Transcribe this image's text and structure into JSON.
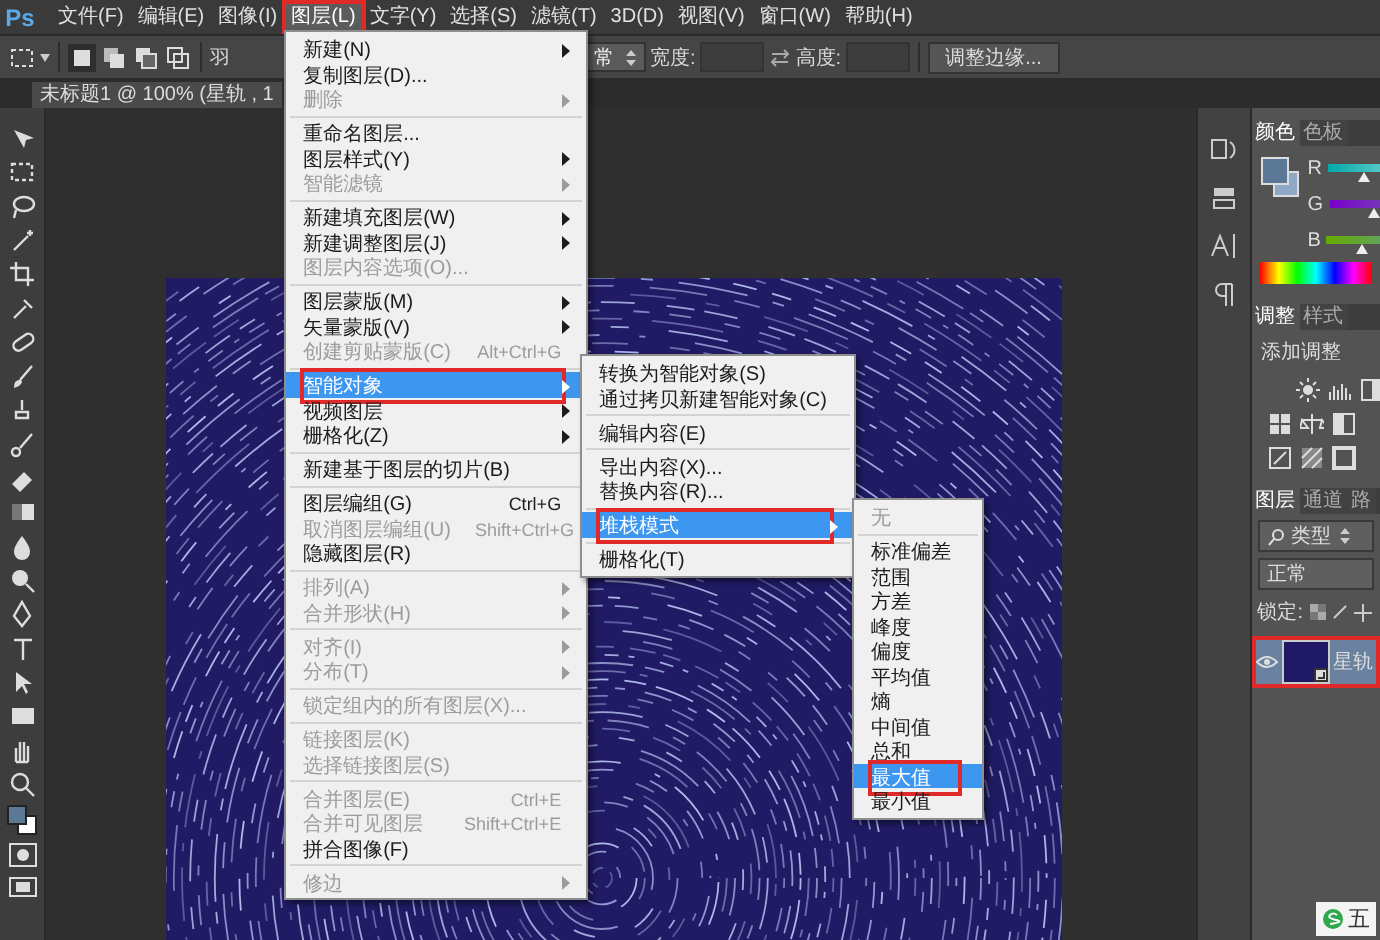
{
  "app_logo": "Ps",
  "menubar": [
    {
      "label": "文件(F)",
      "selected": false,
      "outlined": false
    },
    {
      "label": "编辑(E)",
      "selected": false,
      "outlined": false
    },
    {
      "label": "图像(I)",
      "selected": false,
      "outlined": false
    },
    {
      "label": "图层(L)",
      "selected": true,
      "outlined": true
    },
    {
      "label": "文字(Y)",
      "selected": false,
      "outlined": false
    },
    {
      "label": "选择(S)",
      "selected": false,
      "outlined": false
    },
    {
      "label": "滤镜(T)",
      "selected": false,
      "outlined": false
    },
    {
      "label": "3D(D)",
      "selected": false,
      "outlined": false
    },
    {
      "label": "视图(V)",
      "selected": false,
      "outlined": false
    },
    {
      "label": "窗口(W)",
      "selected": false,
      "outlined": false
    },
    {
      "label": "帮助(H)",
      "selected": false,
      "outlined": false
    }
  ],
  "options_bar": {
    "feather_label": "羽",
    "style_value": "常",
    "width_label": "宽度:",
    "height_label": "高度:",
    "refine_button": "调整边缘..."
  },
  "document_tab": {
    "title": "未标题1 @ 100% (星轨 , 1"
  },
  "layer_menu": {
    "items": [
      {
        "kind": "item",
        "label": "新建(N)",
        "submenu": true,
        "disabled": false,
        "selected": false,
        "outlined": false
      },
      {
        "kind": "item",
        "label": "复制图层(D)...",
        "submenu": false,
        "disabled": false,
        "selected": false,
        "outlined": false
      },
      {
        "kind": "item",
        "label": "删除",
        "submenu": true,
        "disabled": true,
        "selected": false,
        "outlined": false
      },
      {
        "kind": "separator"
      },
      {
        "kind": "item",
        "label": "重命名图层...",
        "submenu": false,
        "disabled": false,
        "selected": false,
        "outlined": false
      },
      {
        "kind": "item",
        "label": "图层样式(Y)",
        "submenu": true,
        "disabled": false,
        "selected": false,
        "outlined": false
      },
      {
        "kind": "item",
        "label": "智能滤镜",
        "submenu": true,
        "disabled": true,
        "selected": false,
        "outlined": false
      },
      {
        "kind": "separator"
      },
      {
        "kind": "item",
        "label": "新建填充图层(W)",
        "submenu": true,
        "disabled": false,
        "selected": false,
        "outlined": false
      },
      {
        "kind": "item",
        "label": "新建调整图层(J)",
        "submenu": true,
        "disabled": false,
        "selected": false,
        "outlined": false
      },
      {
        "kind": "item",
        "label": "图层内容选项(O)...",
        "submenu": false,
        "disabled": true,
        "selected": false,
        "outlined": false
      },
      {
        "kind": "separator"
      },
      {
        "kind": "item",
        "label": "图层蒙版(M)",
        "submenu": true,
        "disabled": false,
        "selected": false,
        "outlined": false
      },
      {
        "kind": "item",
        "label": "矢量蒙版(V)",
        "submenu": true,
        "disabled": false,
        "selected": false,
        "outlined": false
      },
      {
        "kind": "item",
        "label": "创建剪贴蒙版(C)",
        "shortcut": "Alt+Ctrl+G",
        "submenu": false,
        "disabled": true,
        "selected": false,
        "outlined": false
      },
      {
        "kind": "separator"
      },
      {
        "kind": "item",
        "label": "智能对象",
        "submenu": true,
        "disabled": false,
        "selected": true,
        "outlined": true
      },
      {
        "kind": "item",
        "label": "视频图层",
        "submenu": true,
        "disabled": false,
        "selected": false,
        "outlined": false
      },
      {
        "kind": "item",
        "label": "栅格化(Z)",
        "submenu": true,
        "disabled": false,
        "selected": false,
        "outlined": false
      },
      {
        "kind": "separator"
      },
      {
        "kind": "item",
        "label": "新建基于图层的切片(B)",
        "submenu": false,
        "disabled": false,
        "selected": false,
        "outlined": false
      },
      {
        "kind": "separator"
      },
      {
        "kind": "item",
        "label": "图层编组(G)",
        "shortcut": "Ctrl+G",
        "submenu": false,
        "disabled": false,
        "selected": false,
        "outlined": false
      },
      {
        "kind": "item",
        "label": "取消图层编组(U)",
        "shortcut": "Shift+Ctrl+G",
        "submenu": false,
        "disabled": true,
        "selected": false,
        "outlined": false
      },
      {
        "kind": "item",
        "label": "隐藏图层(R)",
        "submenu": false,
        "disabled": false,
        "selected": false,
        "outlined": false
      },
      {
        "kind": "separator"
      },
      {
        "kind": "item",
        "label": "排列(A)",
        "submenu": true,
        "disabled": true,
        "selected": false,
        "outlined": false
      },
      {
        "kind": "item",
        "label": "合并形状(H)",
        "submenu": true,
        "disabled": true,
        "selected": false,
        "outlined": false
      },
      {
        "kind": "separator"
      },
      {
        "kind": "item",
        "label": "对齐(I)",
        "submenu": true,
        "disabled": true,
        "selected": false,
        "outlined": false
      },
      {
        "kind": "item",
        "label": "分布(T)",
        "submenu": true,
        "disabled": true,
        "selected": false,
        "outlined": false
      },
      {
        "kind": "separator"
      },
      {
        "kind": "item",
        "label": "锁定组内的所有图层(X)...",
        "submenu": false,
        "disabled": true,
        "selected": false,
        "outlined": false
      },
      {
        "kind": "separator"
      },
      {
        "kind": "item",
        "label": "链接图层(K)",
        "submenu": false,
        "disabled": true,
        "selected": false,
        "outlined": false
      },
      {
        "kind": "item",
        "label": "选择链接图层(S)",
        "submenu": false,
        "disabled": true,
        "selected": false,
        "outlined": false
      },
      {
        "kind": "separator"
      },
      {
        "kind": "item",
        "label": "合并图层(E)",
        "shortcut": "Ctrl+E",
        "submenu": false,
        "disabled": true,
        "selected": false,
        "outlined": false
      },
      {
        "kind": "item",
        "label": "合并可见图层",
        "shortcut": "Shift+Ctrl+E",
        "submenu": false,
        "disabled": true,
        "selected": false,
        "outlined": false
      },
      {
        "kind": "item",
        "label": "拼合图像(F)",
        "submenu": false,
        "disabled": false,
        "selected": false,
        "outlined": false
      },
      {
        "kind": "separator"
      },
      {
        "kind": "item",
        "label": "修边",
        "submenu": true,
        "disabled": true,
        "selected": false,
        "outlined": false
      }
    ]
  },
  "smart_object_menu": {
    "items": [
      {
        "kind": "item",
        "label": "转换为智能对象(S)",
        "submenu": false,
        "disabled": false,
        "selected": false,
        "outlined": false
      },
      {
        "kind": "item",
        "label": "通过拷贝新建智能对象(C)",
        "submenu": false,
        "disabled": false,
        "selected": false,
        "outlined": false
      },
      {
        "kind": "separator"
      },
      {
        "kind": "item",
        "label": "编辑内容(E)",
        "submenu": false,
        "disabled": false,
        "selected": false,
        "outlined": false
      },
      {
        "kind": "separator"
      },
      {
        "kind": "item",
        "label": "导出内容(X)...",
        "submenu": false,
        "disabled": false,
        "selected": false,
        "outlined": false
      },
      {
        "kind": "item",
        "label": "替换内容(R)...",
        "submenu": false,
        "disabled": false,
        "selected": false,
        "outlined": false
      },
      {
        "kind": "separator"
      },
      {
        "kind": "item",
        "label": "堆栈模式",
        "submenu": true,
        "disabled": false,
        "selected": true,
        "outlined": true
      },
      {
        "kind": "separator"
      },
      {
        "kind": "item",
        "label": "栅格化(T)",
        "submenu": false,
        "disabled": false,
        "selected": false,
        "outlined": false
      }
    ]
  },
  "stack_mode_menu": {
    "items": [
      {
        "kind": "item",
        "label": "无",
        "submenu": false,
        "disabled": true,
        "selected": false,
        "outlined": false
      },
      {
        "kind": "separator"
      },
      {
        "kind": "item",
        "label": "标准偏差",
        "submenu": false,
        "disabled": false,
        "selected": false,
        "outlined": false
      },
      {
        "kind": "item",
        "label": "范围",
        "submenu": false,
        "disabled": false,
        "selected": false,
        "outlined": false
      },
      {
        "kind": "item",
        "label": "方差",
        "submenu": false,
        "disabled": false,
        "selected": false,
        "outlined": false
      },
      {
        "kind": "item",
        "label": "峰度",
        "submenu": false,
        "disabled": false,
        "selected": false,
        "outlined": false
      },
      {
        "kind": "item",
        "label": "偏度",
        "submenu": false,
        "disabled": false,
        "selected": false,
        "outlined": false
      },
      {
        "kind": "item",
        "label": "平均值",
        "submenu": false,
        "disabled": false,
        "selected": false,
        "outlined": false
      },
      {
        "kind": "item",
        "label": "熵",
        "submenu": false,
        "disabled": false,
        "selected": false,
        "outlined": false
      },
      {
        "kind": "item",
        "label": "中间值",
        "submenu": false,
        "disabled": false,
        "selected": false,
        "outlined": false
      },
      {
        "kind": "item",
        "label": "总和",
        "submenu": false,
        "disabled": false,
        "selected": false,
        "outlined": false
      },
      {
        "kind": "item",
        "label": "最大值",
        "submenu": false,
        "disabled": false,
        "selected": true,
        "outlined": true
      },
      {
        "kind": "item",
        "label": "最小值",
        "submenu": false,
        "disabled": false,
        "selected": false,
        "outlined": false
      }
    ]
  },
  "panels": {
    "color": {
      "tabs": [
        {
          "label": "颜色",
          "selected": true
        },
        {
          "label": "色板",
          "selected": false
        }
      ],
      "channels": [
        {
          "name": "R",
          "level": 0.22
        },
        {
          "name": "G",
          "level": 0.28
        },
        {
          "name": "B",
          "level": 0.22
        }
      ]
    },
    "adjustments": {
      "tabs": [
        {
          "label": "调整",
          "selected": true
        },
        {
          "label": "样式",
          "selected": false
        }
      ],
      "title": "添加调整"
    },
    "layers": {
      "tabs": [
        {
          "label": "图层",
          "selected": true
        },
        {
          "label": "通道",
          "selected": false
        },
        {
          "label": "路",
          "selected": false
        }
      ],
      "filter_value": "类型",
      "blend_mode": "正常",
      "lock_label": "锁定:",
      "layers": [
        {
          "name": "星轨",
          "selected": true,
          "outlined": true,
          "visible": true
        }
      ]
    }
  },
  "ime_indicator": "五"
}
